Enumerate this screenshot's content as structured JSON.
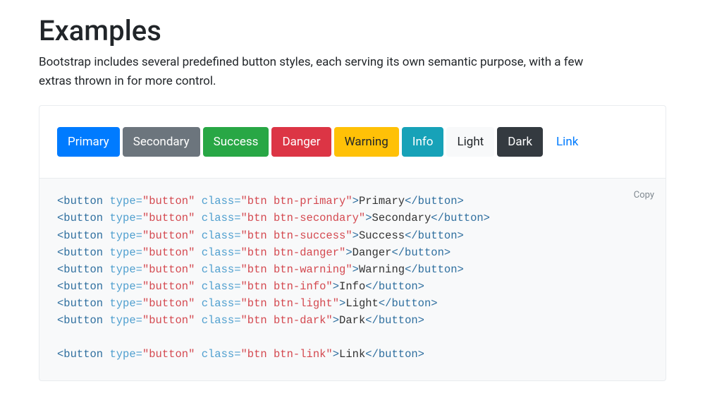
{
  "heading": "Examples",
  "subtitle": "Bootstrap includes several predefined button styles, each serving its own semantic purpose, with a few extras thrown in for more control.",
  "buttons": [
    {
      "label": "Primary",
      "class": "btn-primary",
      "name": "primary-button"
    },
    {
      "label": "Secondary",
      "class": "btn-secondary",
      "name": "secondary-button"
    },
    {
      "label": "Success",
      "class": "btn-success",
      "name": "success-button"
    },
    {
      "label": "Danger",
      "class": "btn-danger",
      "name": "danger-button"
    },
    {
      "label": "Warning",
      "class": "btn-warning",
      "name": "warning-button"
    },
    {
      "label": "Info",
      "class": "btn-info",
      "name": "info-button"
    },
    {
      "label": "Light",
      "class": "btn-light",
      "name": "light-button"
    },
    {
      "label": "Dark",
      "class": "btn-dark",
      "name": "dark-button"
    },
    {
      "label": "Link",
      "class": "btn-link",
      "name": "link-button"
    }
  ],
  "code": {
    "copy_label": "Copy",
    "tag": "button",
    "type_attr": "type",
    "type_val": "button",
    "class_attr": "class",
    "lines": [
      {
        "class_val": "btn btn-primary",
        "text": "Primary"
      },
      {
        "class_val": "btn btn-secondary",
        "text": "Secondary"
      },
      {
        "class_val": "btn btn-success",
        "text": "Success"
      },
      {
        "class_val": "btn btn-danger",
        "text": "Danger"
      },
      {
        "class_val": "btn btn-warning",
        "text": "Warning"
      },
      {
        "class_val": "btn btn-info",
        "text": "Info"
      },
      {
        "class_val": "btn btn-light",
        "text": "Light"
      },
      {
        "class_val": "btn btn-dark",
        "text": "Dark"
      },
      {
        "blank": true
      },
      {
        "class_val": "btn btn-link",
        "text": "Link"
      }
    ]
  }
}
